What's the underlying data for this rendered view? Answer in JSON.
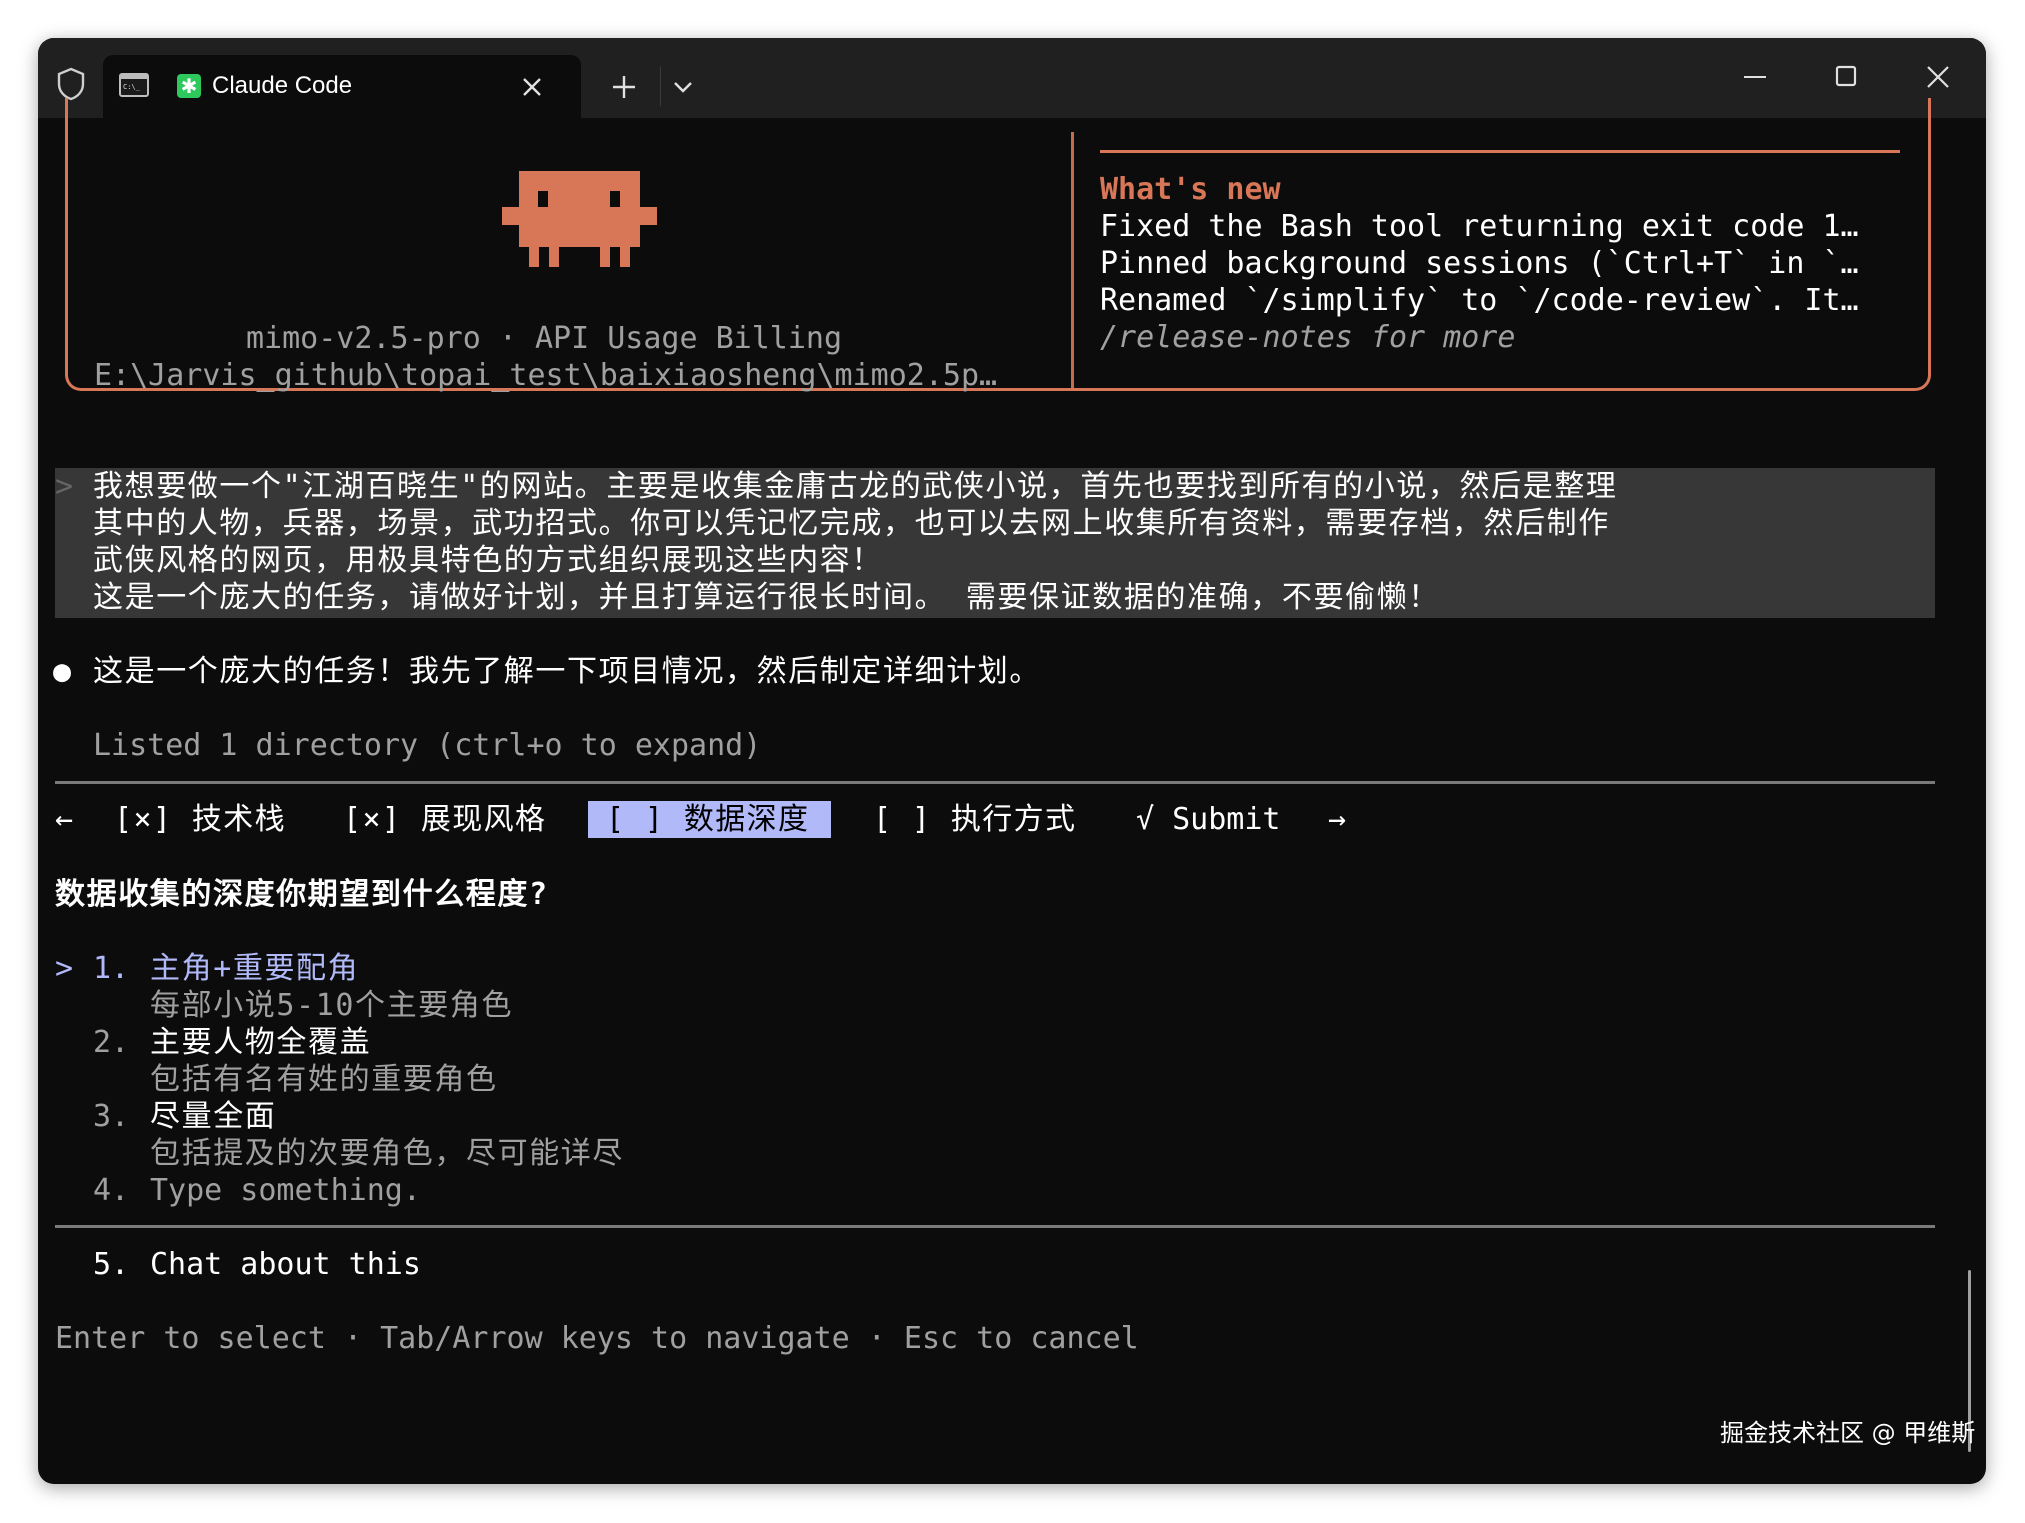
{
  "window": {
    "tab_title": "Claude Code"
  },
  "welcome": {
    "model_line": "mimo-v2.5-pro · API Usage Billing",
    "path_line": "E:\\Jarvis_github\\topai_test\\baixiaosheng\\mimo2.5p…",
    "whats_new_title": "What's new",
    "whats_new_items": [
      "Fixed the Bash tool returning exit code 1…",
      "Pinned background sessions (`Ctrl+T` in `…",
      "Renamed `/simplify` to `/code-review`. It…"
    ],
    "release_notes": "/release-notes for more"
  },
  "user_prompt": {
    "marker": ">",
    "lines": [
      "我想要做一个\"江湖百晓生\"的网站。主要是收集金庸古龙的武侠小说，首先也要找到所有的小说，然后是整理",
      "其中的人物，兵器，场景，武功招式。你可以凭记忆完成，也可以去网上收集所有资料，需要存档，然后制作",
      "武侠风格的网页，用极具特色的方式组织展现这些内容！",
      "这是一个庞大的任务，请做好计划，并且打算运行很长时间。 需要保证数据的准确，不要偷懒！"
    ]
  },
  "assistant": {
    "bullet": "●",
    "message": "这是一个庞大的任务！我先了解一下项目情况，然后制定详细计划。",
    "tool_result": "Listed 1 directory (ctrl+o to expand)"
  },
  "question_tabs": {
    "left_arrow": "←",
    "right_arrow": "→",
    "items": [
      {
        "label": "[×] 技术栈"
      },
      {
        "label": "[×] 展现风格"
      },
      {
        "label": "[ ] 数据深度"
      },
      {
        "label": "[ ] 执行方式"
      },
      {
        "label": "√ Submit"
      }
    ]
  },
  "question": {
    "title": "数据收集的深度你期望到什么程度?",
    "cursor": ">",
    "options": [
      {
        "num": "1.",
        "label": "主角+重要配角",
        "desc": "每部小说5-10个主要角色"
      },
      {
        "num": "2.",
        "label": "主要人物全覆盖",
        "desc": "包括有名有姓的重要角色"
      },
      {
        "num": "3.",
        "label": "尽量全面",
        "desc": "包括提及的次要角色，尽可能详尽"
      },
      {
        "num": "4.",
        "label": "Type something."
      }
    ],
    "chat_option": {
      "num": "5.",
      "label": "Chat about this"
    },
    "footer_hint": "Enter to select · Tab/Arrow keys to navigate · Esc to cancel"
  },
  "watermark": "掘金技术社区 @ 甲维斯",
  "colors": {
    "background": "#0c0c0c",
    "accent_orange": "#d77757",
    "selection_purple": "#b1b9f9",
    "text": "#ffffff",
    "dim_text": "#a0a0a0"
  }
}
